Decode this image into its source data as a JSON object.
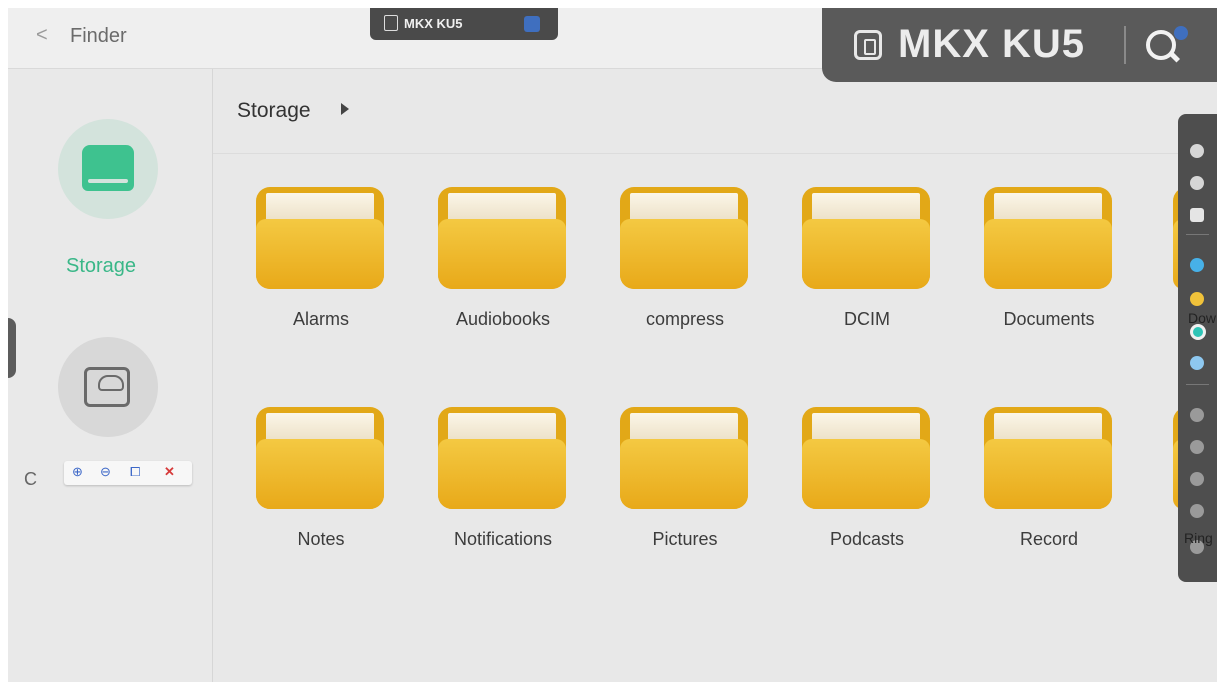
{
  "topbar": {
    "back_icon": "chevron-left-icon",
    "title": "Finder"
  },
  "mini_tag": {
    "label": "MKX KU5"
  },
  "device_banner": {
    "label": "MKX KU5",
    "icon": "device-icon",
    "search_icon": "search-icon"
  },
  "sidebar": {
    "items": [
      {
        "label": "Storage",
        "icon": "drive-icon",
        "active": true,
        "color": "#3ab788"
      },
      {
        "label": "C",
        "icon": "cloud-drive-icon",
        "active": false
      }
    ],
    "zoom_controls": {
      "zoom_in": "⊕",
      "zoom_out": "⊖",
      "fit": "⧠",
      "close": "✕"
    }
  },
  "breadcrumb": {
    "label": "Storage"
  },
  "folders": [
    {
      "name": "Alarms"
    },
    {
      "name": "Audiobooks"
    },
    {
      "name": "compress"
    },
    {
      "name": "DCIM"
    },
    {
      "name": "Documents"
    },
    {
      "name": "Notes"
    },
    {
      "name": "Notifications"
    },
    {
      "name": "Pictures"
    },
    {
      "name": "Podcasts"
    },
    {
      "name": "Record"
    }
  ],
  "cut_off_labels": {
    "row1": "Dow",
    "row2": "Ring"
  },
  "colors": {
    "folder": "#e8a919",
    "accent": "#3ec28f",
    "banner": "#5a5a5a"
  }
}
